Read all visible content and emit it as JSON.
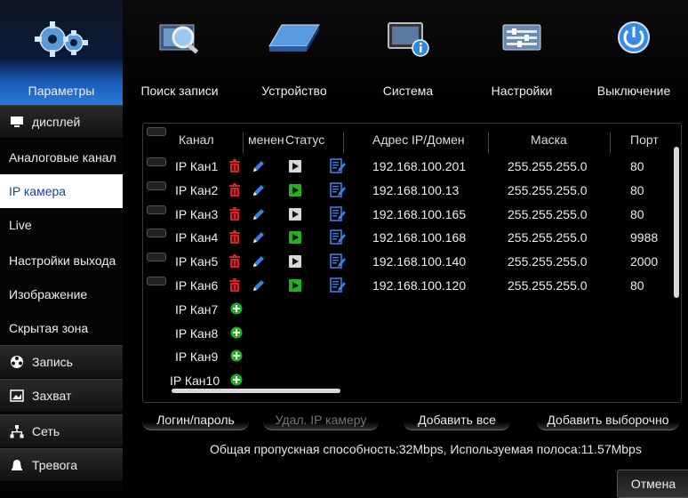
{
  "nav": {
    "tabs": [
      {
        "label": "Параметры",
        "icon": "gears-icon"
      },
      {
        "label": "Поиск записи",
        "icon": "magnifier-icon"
      },
      {
        "label": "Устройство",
        "icon": "hard-drive-icon"
      },
      {
        "label": "Система",
        "icon": "system-info-icon"
      },
      {
        "label": "Настройки",
        "icon": "settings-panel-icon"
      },
      {
        "label": "Выключение",
        "icon": "power-icon"
      }
    ]
  },
  "sidebar": {
    "items": [
      {
        "label": "дисплей",
        "icon": "monitor-icon"
      },
      {
        "label": "Аналоговые канал"
      },
      {
        "label": "IP камера"
      },
      {
        "label": "Live"
      },
      {
        "label": "Настройки выхода"
      },
      {
        "label": "Изображение"
      },
      {
        "label": "Скрытая зона"
      },
      {
        "label": "Запись",
        "icon": "record-reel-icon"
      },
      {
        "label": "Захват",
        "icon": "capture-icon"
      },
      {
        "label": "Сеть",
        "icon": "network-icon"
      },
      {
        "label": "Тревога",
        "icon": "alarm-icon"
      }
    ]
  },
  "table": {
    "headers": {
      "channel": "Канал",
      "edit": "менен",
      "status": "Статус",
      "ip": "Адрес IP/Домен",
      "mask": "Маска",
      "port": "Порт"
    },
    "rows": [
      {
        "channel": "IP Кан1",
        "status": "offline",
        "ip": "192.168.100.201",
        "mask": "255.255.255.0",
        "port": "80"
      },
      {
        "channel": "IP Кан2",
        "status": "online",
        "ip": "192.168.100.13",
        "mask": "255.255.255.0",
        "port": "80"
      },
      {
        "channel": "IP Кан3",
        "status": "offline",
        "ip": "192.168.100.165",
        "mask": "255.255.255.0",
        "port": "80"
      },
      {
        "channel": "IP Кан4",
        "status": "online",
        "ip": "192.168.100.168",
        "mask": "255.255.255.0",
        "port": "9988"
      },
      {
        "channel": "IP Кан5",
        "status": "offline",
        "ip": "192.168.100.140",
        "mask": "255.255.255.0",
        "port": "2000"
      },
      {
        "channel": "IP Кан6",
        "status": "online",
        "ip": "192.168.100.120",
        "mask": "255.255.255.0",
        "port": "80"
      }
    ],
    "empty_rows": [
      {
        "channel": "IP Кан7"
      },
      {
        "channel": "IP Кан8"
      },
      {
        "channel": "IP Кан9"
      },
      {
        "channel": "IP Кан10"
      }
    ]
  },
  "actions": {
    "login": "Логин/пароль",
    "delete": "Удал. IP камеру",
    "add_all": "Добавить все",
    "add_selected": "Добавить выборочно"
  },
  "bandwidth": "Общая пропускная способность:32Mbps, Используемая полоса:11.57Mbps",
  "cancel": "Отмена",
  "colors": {
    "accent": "#2a7ad8",
    "delete": "#d42020",
    "online": "#22b020",
    "offline": "#d8d8d8",
    "edit": "#3a80e0"
  }
}
